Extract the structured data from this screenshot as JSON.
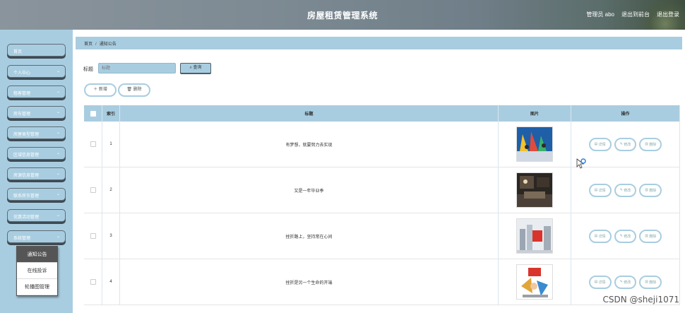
{
  "header": {
    "title": "房屋租赁管理系统",
    "admin_label": "管理员 abo",
    "backstage_link": "退出到前台",
    "logout_link": "退出登录"
  },
  "sidebar": {
    "items": [
      {
        "label": "首页"
      },
      {
        "label": "个人中心"
      },
      {
        "label": "租客管理"
      },
      {
        "label": "房东管理"
      },
      {
        "label": "房屋类型管理"
      },
      {
        "label": "区域信息管理"
      },
      {
        "label": "房源信息管理"
      },
      {
        "label": "联系房东管理"
      },
      {
        "label": "优惠活动管理"
      },
      {
        "label": "系统管理"
      }
    ],
    "submenu": [
      {
        "label": "通知公告"
      },
      {
        "label": "在线投诉"
      },
      {
        "label": "轮播图管理"
      }
    ]
  },
  "breadcrumb": {
    "home": "首页",
    "current": "通知公告"
  },
  "search": {
    "label": "标题",
    "placeholder": "标题",
    "query_button": "查询"
  },
  "toolbar": {
    "add_button": "新增",
    "delete_button": "删除"
  },
  "table": {
    "headers": {
      "index": "索引",
      "title": "标题",
      "image": "图片",
      "actions": "操作"
    },
    "rows": [
      {
        "index": "1",
        "title": "有梦想，就要努力去实现"
      },
      {
        "index": "2",
        "title": "又是一年毕业季"
      },
      {
        "index": "3",
        "title": "挫折路上，坚持常在心间"
      },
      {
        "index": "4",
        "title": "挫折是另一个生命的开端"
      }
    ],
    "actions": {
      "detail": "详情",
      "edit": "修改",
      "delete": "删除"
    }
  },
  "watermark": "CSDN @sheji1071",
  "colors": {
    "accent": "#a9cde0",
    "header_start": "#8a949c",
    "header_end": "#3f4f3f"
  }
}
